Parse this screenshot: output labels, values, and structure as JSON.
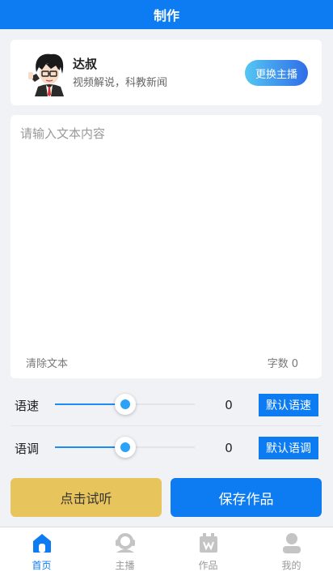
{
  "header": {
    "title": "制作"
  },
  "anchor": {
    "name": "达叔",
    "description": "视频解说，科教新闻",
    "switch_label": "更换主播"
  },
  "editor": {
    "placeholder": "请输入文本内容",
    "value": "",
    "clear_label": "清除文本",
    "count_label": "字数",
    "count_value": "0"
  },
  "speed": {
    "label": "语速",
    "value": "0",
    "level_fraction": 0.5,
    "default_label": "默认语速"
  },
  "tone": {
    "label": "语调",
    "value": "0",
    "level_fraction": 0.5,
    "default_label": "默认语调"
  },
  "actions": {
    "listen_label": "点击试听",
    "save_label": "保存作品"
  },
  "tabs": [
    {
      "label": "首页",
      "icon": "home-icon",
      "active": true
    },
    {
      "label": "主播",
      "icon": "anchor-icon",
      "active": false
    },
    {
      "label": "作品",
      "icon": "works-icon",
      "active": false
    },
    {
      "label": "我的",
      "icon": "profile-icon",
      "active": false
    }
  ],
  "colors": {
    "primary": "#0d7cf2",
    "listen_button": "#e7c45c",
    "slider_thumb": "#2aa2f8"
  }
}
